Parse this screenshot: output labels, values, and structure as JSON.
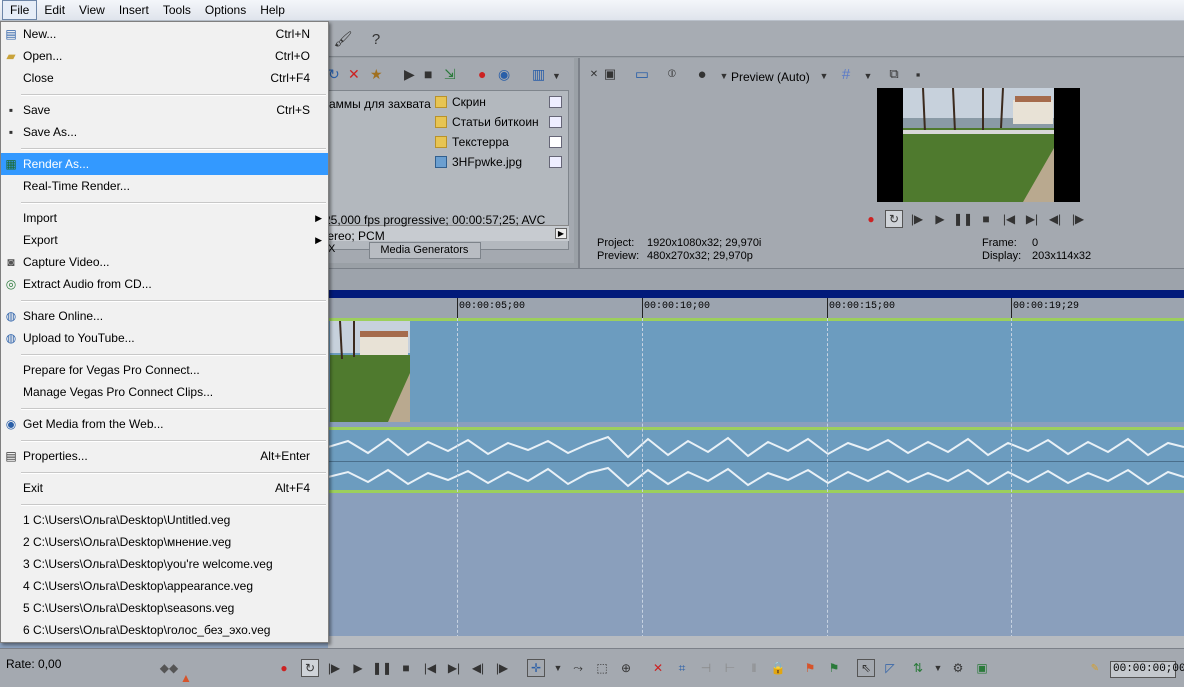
{
  "menubar": {
    "items": [
      "File",
      "Edit",
      "View",
      "Insert",
      "Tools",
      "Options",
      "Help"
    ]
  },
  "explorer": {
    "left_text": "аммы для захвата",
    "files": [
      "Скрин",
      "Статьи биткоин",
      "Текстерра",
      "3HFpwke.jpg"
    ],
    "props_line1": "25,000 fps progressive; 00:00:57;25; AVC",
    "props_line2": "tereo; PCM",
    "tab_left": "X",
    "tab_media": "Media Generators"
  },
  "preview": {
    "mode_label": "Preview (Auto)",
    "project_label": "Project:",
    "project_value": "1920x1080x32; 29,970i",
    "preview_label": "Preview:",
    "preview_value": "480x270x32; 29,970p",
    "frame_label": "Frame:",
    "frame_value": "0",
    "display_label": "Display:",
    "display_value": "203x114x32"
  },
  "timeline": {
    "ticks": [
      "00:00:05;00",
      "00:00:10;00",
      "00:00:15;00",
      "00:00:19;29"
    ]
  },
  "status": {
    "rate": "Rate: 0,00",
    "timecode": "00:00:00;00"
  },
  "file_menu": {
    "new": {
      "label": "New...",
      "shortcut": "Ctrl+N"
    },
    "open": {
      "label": "Open...",
      "shortcut": "Ctrl+O"
    },
    "close": {
      "label": "Close",
      "shortcut": "Ctrl+F4"
    },
    "save": {
      "label": "Save",
      "shortcut": "Ctrl+S"
    },
    "save_as": {
      "label": "Save As..."
    },
    "render_as": {
      "label": "Render As..."
    },
    "realtime_render": {
      "label": "Real-Time Render..."
    },
    "import": {
      "label": "Import"
    },
    "export": {
      "label": "Export"
    },
    "capture_video": {
      "label": "Capture Video..."
    },
    "extract_audio": {
      "label": "Extract Audio from CD..."
    },
    "share_online": {
      "label": "Share Online..."
    },
    "upload_youtube": {
      "label": "Upload to YouTube..."
    },
    "prepare_connect": {
      "label": "Prepare for Vegas Pro Connect..."
    },
    "manage_connect": {
      "label": "Manage Vegas Pro Connect Clips..."
    },
    "get_media_web": {
      "label": "Get Media from the Web..."
    },
    "properties": {
      "label": "Properties...",
      "shortcut": "Alt+Enter"
    },
    "exit": {
      "label": "Exit",
      "shortcut": "Alt+F4"
    },
    "recent": [
      "1 C:\\Users\\Ольга\\Desktop\\Untitled.veg",
      "2 C:\\Users\\Ольга\\Desktop\\мнение.veg",
      "3 C:\\Users\\Ольга\\Desktop\\you're welcome.veg",
      "4 C:\\Users\\Ольга\\Desktop\\appearance.veg",
      "5 C:\\Users\\Ольга\\Desktop\\seasons.veg",
      "6 C:\\Users\\Ольга\\Desktop\\голос_без_эхо.veg"
    ]
  }
}
